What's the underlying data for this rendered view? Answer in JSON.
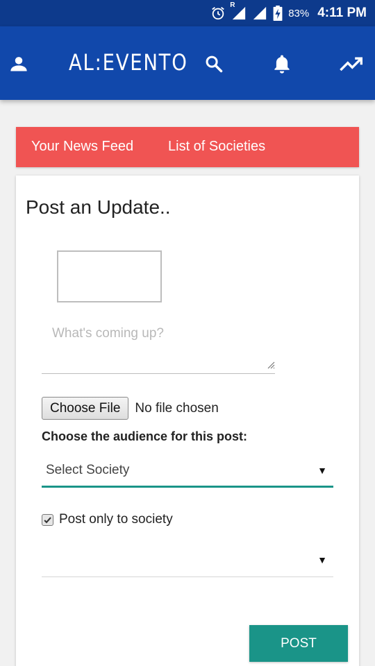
{
  "status_bar": {
    "alarm_icon": "alarm-clock-icon",
    "roaming": "R",
    "signal_icons": [
      "signal-icon",
      "signal-icon"
    ],
    "battery_icon": "battery-charging-icon",
    "battery_percent": "83%",
    "time": "4:11 PM"
  },
  "app_bar": {
    "brand": "AL:EVENTO",
    "icons": [
      "profile-icon",
      "search-icon",
      "notification-bell-icon",
      "trending-icon"
    ],
    "color": "#1148ab"
  },
  "tabs": [
    {
      "label": "Your News Feed"
    },
    {
      "label": "List of Societies"
    }
  ],
  "tabs_color": "#f05453",
  "post_form": {
    "title": "Post an Update..",
    "textarea_placeholder": "What's coming up?",
    "file_button_label": "Choose File",
    "file_status": "No file chosen",
    "audience_label": "Choose the audience for this post:",
    "society_select_value": "Select Society",
    "post_only_checked": true,
    "post_only_label": "Post only to society",
    "second_select_value": "",
    "submit_label": "POST",
    "accent_color": "#1a9488"
  }
}
